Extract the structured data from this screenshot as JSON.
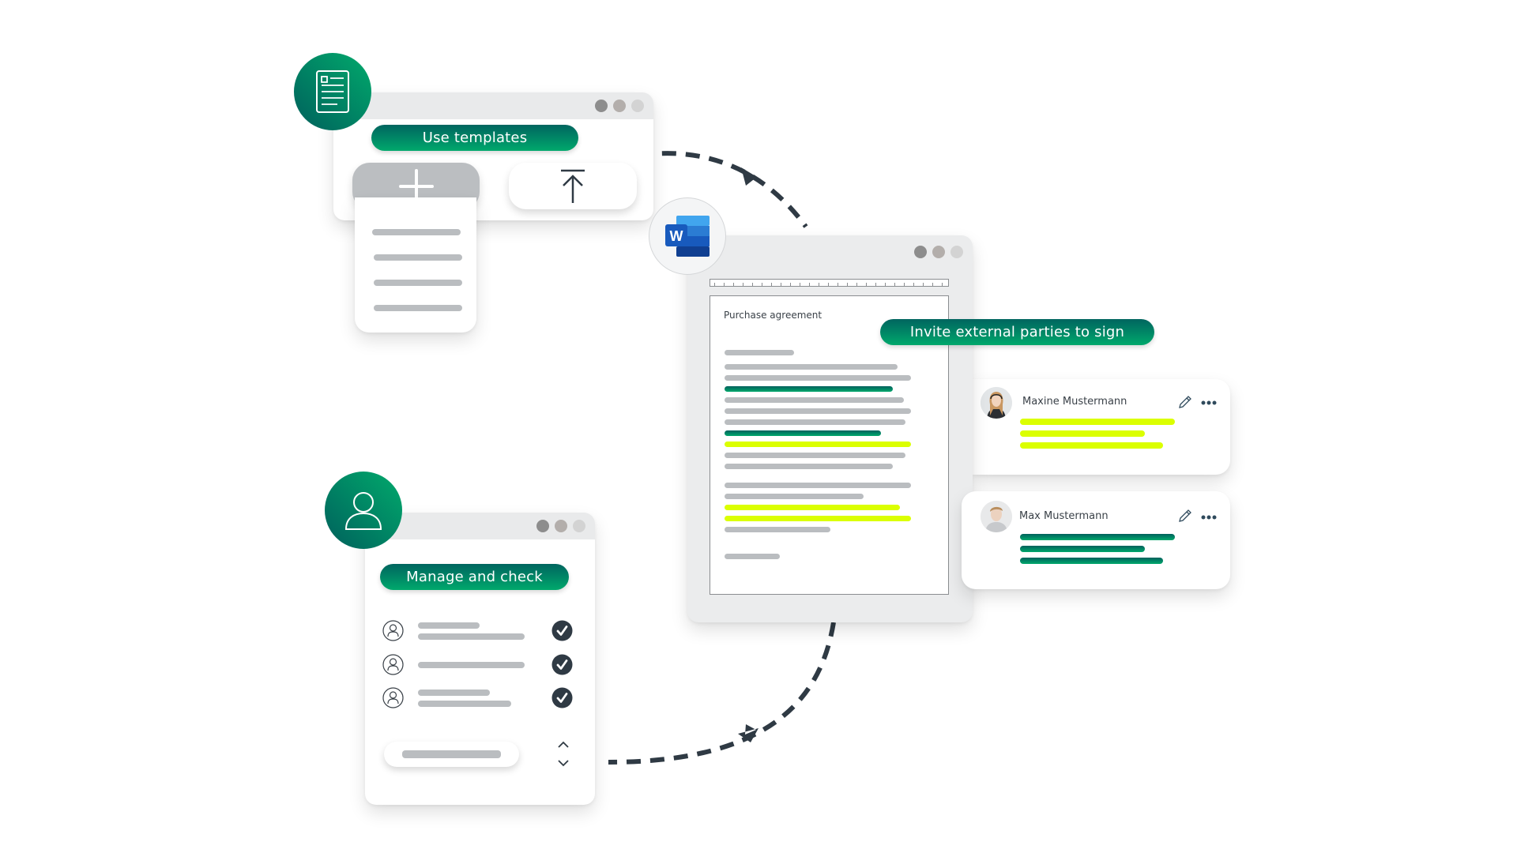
{
  "templates_panel": {
    "badge_icon": "document-list-icon",
    "title": "Use templates",
    "create_button_icon": "plus-icon",
    "upload_button_icon": "upload-icon",
    "window_controls": [
      "window-dot",
      "window-dot",
      "window-dot"
    ]
  },
  "word_badge": {
    "icon": "microsoft-word-icon",
    "letter": "W"
  },
  "document_panel": {
    "document_title": "Purchase agreement",
    "ruler_icon": "ruler-icon"
  },
  "invite_panel": {
    "title": "Invite external parties to sign",
    "signers": [
      {
        "name": "Maxine Mustermann",
        "status_color": "#dbff00",
        "edit_icon": "pencil-icon",
        "more_icon": "more-dots-icon"
      },
      {
        "name": "Max Mustermann",
        "status_color": "#00855f",
        "edit_icon": "pencil-icon",
        "more_icon": "more-dots-icon"
      }
    ]
  },
  "manage_panel": {
    "badge_icon": "user-icon",
    "title": "Manage and check",
    "rows": [
      {
        "icon": "user-circle-icon",
        "status": "check-icon"
      },
      {
        "icon": "user-circle-icon",
        "status": "check-icon"
      },
      {
        "icon": "user-circle-icon",
        "status": "check-icon"
      }
    ],
    "scroll_up_icon": "chevron-up-icon",
    "scroll_down_icon": "chevron-down-icon"
  },
  "colors": {
    "brand_dark": "#00605c",
    "brand_light": "#00a86c",
    "highlight": "#dbff00",
    "placeholder_bar": "#babdc0",
    "arrow": "#2f3a44"
  }
}
